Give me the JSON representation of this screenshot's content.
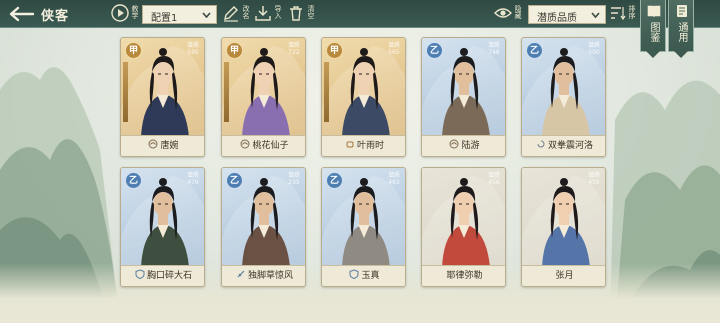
{
  "header": {
    "title": "侠客",
    "icons": {
      "back": "arrow-left-icon"
    }
  },
  "toolbar": {
    "play_label": "教学",
    "config_select": {
      "value": "配置1"
    },
    "edit_label": "改名",
    "import_label": "导入",
    "clear_label": "清空",
    "view_label": "隐藏",
    "sort_select": {
      "value": "潜质品质"
    },
    "sort_order_label": "排序"
  },
  "side_tabs": [
    {
      "label": "图鉴",
      "icon": "book-icon"
    },
    {
      "label": "通用",
      "icon": "scroll-icon"
    }
  ],
  "colors": {
    "topbar": "#2f4a43",
    "gold_card": "#e3c48b",
    "blue_card": "#b8cde0",
    "grade_gold": "#b98a3e",
    "grade_blue": "#4f7fb2",
    "name_text": "#3b3426"
  },
  "cards": [
    {
      "name": "唐婉",
      "grade": "甲",
      "tier": "gold",
      "stat": "潜质 595",
      "school_icon": "lotus-icon"
    },
    {
      "name": "桃花仙子",
      "grade": "甲",
      "tier": "gold",
      "stat": "潜质 722",
      "school_icon": "lotus-icon"
    },
    {
      "name": "叶雨时",
      "grade": "甲",
      "tier": "gold",
      "stat": "潜质 565",
      "school_icon": "fist-icon"
    },
    {
      "name": "陆游",
      "grade": "乙",
      "tier": "blue",
      "stat": "潜质 746",
      "school_icon": "lotus-icon"
    },
    {
      "name": "双拳震河洛",
      "grade": "乙",
      "tier": "blue",
      "stat": "潜质 500",
      "school_icon": "swirl-icon"
    },
    {
      "name": "胸口碎大石",
      "grade": "乙",
      "tier": "blue",
      "stat": "潜质 479",
      "school_icon": "shield-icon"
    },
    {
      "name": "独脚草惊风",
      "grade": "乙",
      "tier": "blue",
      "stat": "潜质 235",
      "school_icon": "sword-icon"
    },
    {
      "name": "玉真",
      "grade": "乙",
      "tier": "blue",
      "stat": "潜质 463",
      "school_icon": "shield-icon"
    },
    {
      "name": "耶律弥勒",
      "grade": "",
      "tier": "plain",
      "stat": "潜质 456",
      "school_icon": ""
    },
    {
      "name": "张月",
      "grade": "",
      "tier": "plain",
      "stat": "潜质 455",
      "school_icon": ""
    }
  ]
}
